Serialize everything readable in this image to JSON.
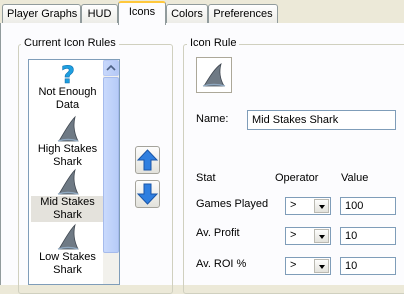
{
  "tabs": [
    {
      "label": "Player Graphs"
    },
    {
      "label": "HUD"
    },
    {
      "label": "Icons"
    },
    {
      "label": "Colors"
    },
    {
      "label": "Preferences"
    }
  ],
  "active_tab": "Icons",
  "left_group": {
    "title": "Current Icon Rules",
    "items": [
      {
        "label_line1": "Not Enough",
        "label_line2": "Data",
        "icon": "question-mark-icon"
      },
      {
        "label_line1": "High Stakes",
        "label_line2": "Shark",
        "icon": "shark-fin-icon"
      },
      {
        "label_line1": "Mid Stakes",
        "label_line2": "Shark",
        "icon": "shark-fin-icon",
        "selected": true
      },
      {
        "label_line1": "Low Stakes",
        "label_line2": "Shark",
        "icon": "shark-fin-icon"
      }
    ]
  },
  "move_up_icon": "arrow-up-icon",
  "move_down_icon": "arrow-down-icon",
  "right_group": {
    "title": "Icon Rule",
    "name_label": "Name:",
    "name_value": "Mid Stakes Shark",
    "headers": {
      "stat": "Stat",
      "operator": "Operator",
      "value": "Value"
    },
    "rows": [
      {
        "stat": "Games Played",
        "operator": ">",
        "value": "100"
      },
      {
        "stat": "Av. Profit",
        "operator": ">",
        "value": "10"
      },
      {
        "stat": "Av. ROI %",
        "operator": ">",
        "value": "10"
      }
    ]
  },
  "colors": {
    "accent_tab": "#ffc83c",
    "arrow_blue": "#1e6fd6"
  }
}
